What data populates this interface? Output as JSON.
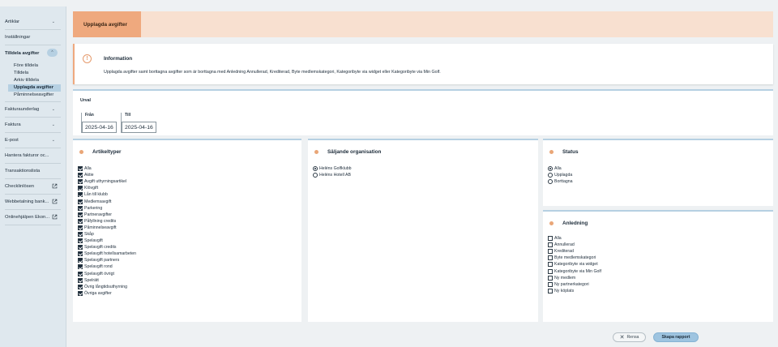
{
  "sidebar": {
    "items": [
      {
        "label": "Artiklar",
        "chevron": true
      },
      {
        "label": "Inställningar"
      }
    ],
    "open_section": {
      "label": "Tilldela avgifter",
      "children": [
        "Före tilldela",
        "Tilldela",
        "Arkiv tilldela",
        "Upplagda avgifter",
        "Påminnelseavgifter"
      ],
      "active": "Upplagda avgifter"
    },
    "items_after": [
      {
        "label": "Fakturaunderlag",
        "chevron": true
      },
      {
        "label": "Faktura",
        "chevron": true
      },
      {
        "label": "E-post",
        "chevron": true
      },
      {
        "label": "Hantera fakturor oc..."
      },
      {
        "label": "Transaktionslista"
      },
      {
        "label": "Checklinlösen",
        "external": true
      },
      {
        "label": "Webbetalning bank...",
        "external": true
      },
      {
        "label": "Onlinehjälpen Ekon...",
        "external": true
      }
    ]
  },
  "header": {
    "tab": "Upplagda avgifter"
  },
  "info": {
    "title": "Information",
    "text": "Upplagda avgifter samt borttagna avgifter som är borttagna med Anledning Annullerad, Krediterad, Byte medlemskategori, Kategoribyte via widget eller Kategoribyte via Min Golf."
  },
  "urval": {
    "title": "Urval",
    "from_label": "Från",
    "from_value": "2025-04-16",
    "to_label": "Till",
    "to_value": "2025-04-16"
  },
  "artikeltyper": {
    "title": "Artikeltyper",
    "items": [
      "Alla",
      "Aktie",
      "Avgift uthyrningsartikel",
      "Klövgift",
      "Lån till klubb",
      "Medlemsavgift",
      "Parkering",
      "Partneravgifter",
      "Påfyllning credits",
      "Påminnelseavgift",
      "Skåp",
      "Spelavgift",
      "Spelavgift credits",
      "Spelavgift hotellsamarbeten",
      "Spelavgift partners",
      "Spelavgift rond",
      "Spelavgift övrigt",
      "Spelrätt",
      "Övrig långtidsuthyrning",
      "Övriga avgifter"
    ]
  },
  "saljande": {
    "title": "Säljande organisation",
    "items": [
      "Heléns Golfklubb",
      "Heléns Hotell AB"
    ],
    "selected": 0
  },
  "status": {
    "title": "Status",
    "items": [
      "Alla",
      "Upplagda",
      "Borttagna"
    ],
    "selected": 0
  },
  "anledning": {
    "title": "Anledning",
    "items": [
      "Alla",
      "Annullerad",
      "Krediterad",
      "Byte medlemskategori",
      "Kategoribyte via widget",
      "Kategoribyte via Min Golf",
      "Ny medlem",
      "Ny partnerkategori",
      "Ny köplats"
    ]
  },
  "actions": {
    "rensa": "Rensa",
    "skapa": "Skapa rapport"
  }
}
